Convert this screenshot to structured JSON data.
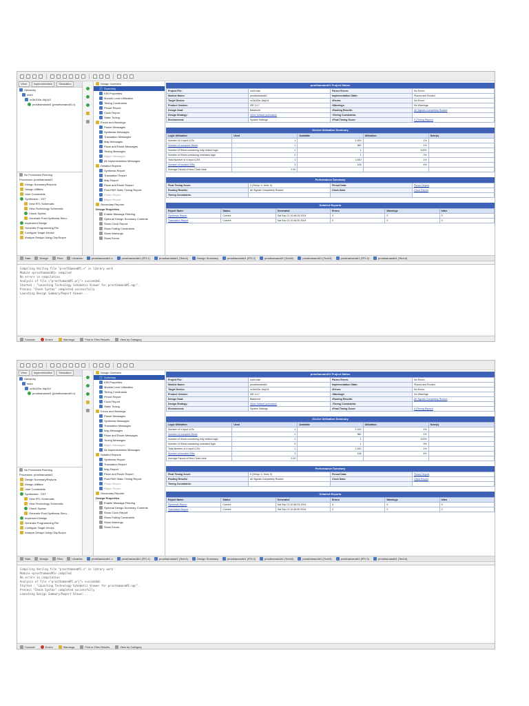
{
  "project_status": {
    "title": "prosthamand#1 Project Status",
    "rows": [
      [
        "Project File:",
        "mshr.xise",
        "Parser Errors:",
        "No Errors"
      ],
      [
        "Module Name:",
        "prosthamand#1",
        "Implementation State:",
        "Placed and Routed"
      ],
      [
        "Target Device:",
        "xc3s100e-4tq144",
        "•Errors:",
        "No Errors"
      ],
      [
        "Product Version:",
        "ISE 14.7",
        "•Warnings:",
        "No Warnings"
      ],
      [
        "Design Goal:",
        "Balanced",
        "•Routing Results:",
        "All Signals Completely Routed"
      ],
      [
        "Design Strategy:",
        "Xilinx Default (unlocked)",
        "•Timing Constraints:",
        ""
      ],
      [
        "Environment:",
        "System Settings",
        "•Final Timing Score:",
        "0 (Timing Report)"
      ]
    ]
  },
  "device_util": {
    "title": "Device Utilization Summary",
    "headers": [
      "Logic Utilization",
      "Used",
      "Available",
      "Utilization",
      "Note(s)"
    ],
    "rows": [
      [
        "Number of 4 input LUTs",
        "1",
        "1,920",
        "1%",
        ""
      ],
      [
        "Number of occupied Slices",
        "1",
        "960",
        "1%",
        ""
      ],
      [
        "Number of Slices containing only related logic",
        "1",
        "1",
        "100%",
        ""
      ],
      [
        "Number of Slices containing unrelated logic",
        "0",
        "1",
        "0%",
        ""
      ],
      [
        "Total Number of 4 input LUTs",
        "1",
        "1,920",
        "1%",
        ""
      ],
      [
        "Number of bonded IOBs",
        "3",
        "108",
        "4%",
        ""
      ],
      [
        "Average Fanout of Non-Clock Nets",
        "2.00",
        "",
        "",
        ""
      ]
    ]
  },
  "performance": {
    "title": "Performance Summary",
    "rows": [
      [
        "Final Timing Score:",
        "0 (Setup: 0, Hold: 0)",
        "Pinout Data:",
        "Pinout Report"
      ],
      [
        "Routing Results:",
        "All Signals Completely Routed",
        "Clock Data:",
        "Clock Report"
      ],
      [
        "Timing Constraints:",
        "",
        "",
        ""
      ]
    ]
  },
  "detailed_reports": {
    "title": "Detailed Reports",
    "headers": [
      "Report Name",
      "Status",
      "Generated",
      "Errors",
      "Warnings",
      "Infos"
    ],
    "rows": [
      [
        "Synthesis Report",
        "Current",
        "Sat Sep 21 10:46:24 2024",
        "0",
        "0",
        "0"
      ],
      [
        "Translation Report",
        "Current",
        "Sat Sep 21 10:46:30 2024",
        "0",
        "0",
        "0"
      ]
    ]
  },
  "hierarchy": {
    "tabs": [
      "View:",
      "Implementation",
      "Simulation"
    ],
    "items": [
      "Hierarchy",
      "mshr",
      "xc3s100e-4tq144",
      "prosthamand#1 (prosthamand#1.v)"
    ]
  },
  "no_processes": "No Processes Running",
  "processes": {
    "header": "Processes: prosthamand#1",
    "items": [
      "Design Summary/Reports",
      "Design Utilities",
      "User Constraints",
      "Synthesize - XST",
      "View RTL Schematic",
      "View Technology Schematic",
      "Check Syntax",
      "Generate Post-Synthesis Simu...",
      "Implement Design",
      "Generate Programming File",
      "Configure Target Device",
      "Analyze Design Using ChipScope"
    ]
  },
  "summary_tree": {
    "items": [
      {
        "t": "Design Overview",
        "lvl": 0
      },
      {
        "t": "Summary",
        "lvl": 1,
        "sel": true
      },
      {
        "t": "IOB Properties",
        "lvl": 1
      },
      {
        "t": "Module Level Utilization",
        "lvl": 1
      },
      {
        "t": "Timing Constraints",
        "lvl": 1
      },
      {
        "t": "Pinout Report",
        "lvl": 1
      },
      {
        "t": "Clock Report",
        "lvl": 1
      },
      {
        "t": "Static Timing",
        "lvl": 1
      },
      {
        "t": "Errors and Warnings",
        "lvl": 0
      },
      {
        "t": "Parser Messages",
        "lvl": 1
      },
      {
        "t": "Synthesis Messages",
        "lvl": 1
      },
      {
        "t": "Translation Messages",
        "lvl": 1
      },
      {
        "t": "Map Messages",
        "lvl": 1
      },
      {
        "t": "Place and Route Messages",
        "lvl": 1
      },
      {
        "t": "Timing Messages",
        "lvl": 1
      },
      {
        "t": "Bitgen Messages",
        "lvl": 1,
        "dim": true
      },
      {
        "t": "All Implementation Messages",
        "lvl": 1
      },
      {
        "t": "Detailed Reports",
        "lvl": 0
      },
      {
        "t": "Synthesis Report",
        "lvl": 1
      },
      {
        "t": "Translation Report",
        "lvl": 1
      },
      {
        "t": "Map Report",
        "lvl": 1
      },
      {
        "t": "Place and Route Report",
        "lvl": 1
      },
      {
        "t": "Post-PAR Static Timing Report",
        "lvl": 1
      },
      {
        "t": "Power Report",
        "lvl": 1,
        "dim": true
      },
      {
        "t": "Bitgen Report",
        "lvl": 1,
        "dim": true
      },
      {
        "t": "Secondary Reports",
        "lvl": 0
      }
    ],
    "props_header": "Design Properties",
    "props": [
      "Enable Message Filtering",
      "Optional Design Summary Contents",
      "Show Clock Report",
      "Show Failing Constraints",
      "Show Warnings",
      "Show Errors"
    ]
  },
  "bottom_tabs": [
    "Start",
    "Design",
    "Files",
    "Libraries",
    "prosthamand#1.v",
    "prosthamand#1 (RTL1)",
    "prosthamand#1 (Tech1)",
    "Design Summary",
    "prosthamand#1 (RTL2)",
    "prosthamand#1 (Tech2)",
    "prosthamand#1 (Tech3)",
    "prosthamand#1 (RTL3)",
    "prosthamand#1 (Tech4)"
  ],
  "console": [
    "Compiling Verilog file \"prosthamand#1.v\" in library work",
    "Module <prosthamand#1> compiled",
    "No errors in compilation",
    "Analysis of file <\"prosthamand#1.prj\"> succeeded.",
    "",
    "Started : \"Launching Technology Schematic Viewer for prosthamand#1.ngc\".",
    "",
    "Process \"Check Syntax\" completed successfully",
    "Launching Design Summary/Report Viewer..."
  ],
  "status_tabs": [
    "Console",
    "Errors",
    "Warnings",
    "Find in Files Results",
    "View by Category"
  ]
}
